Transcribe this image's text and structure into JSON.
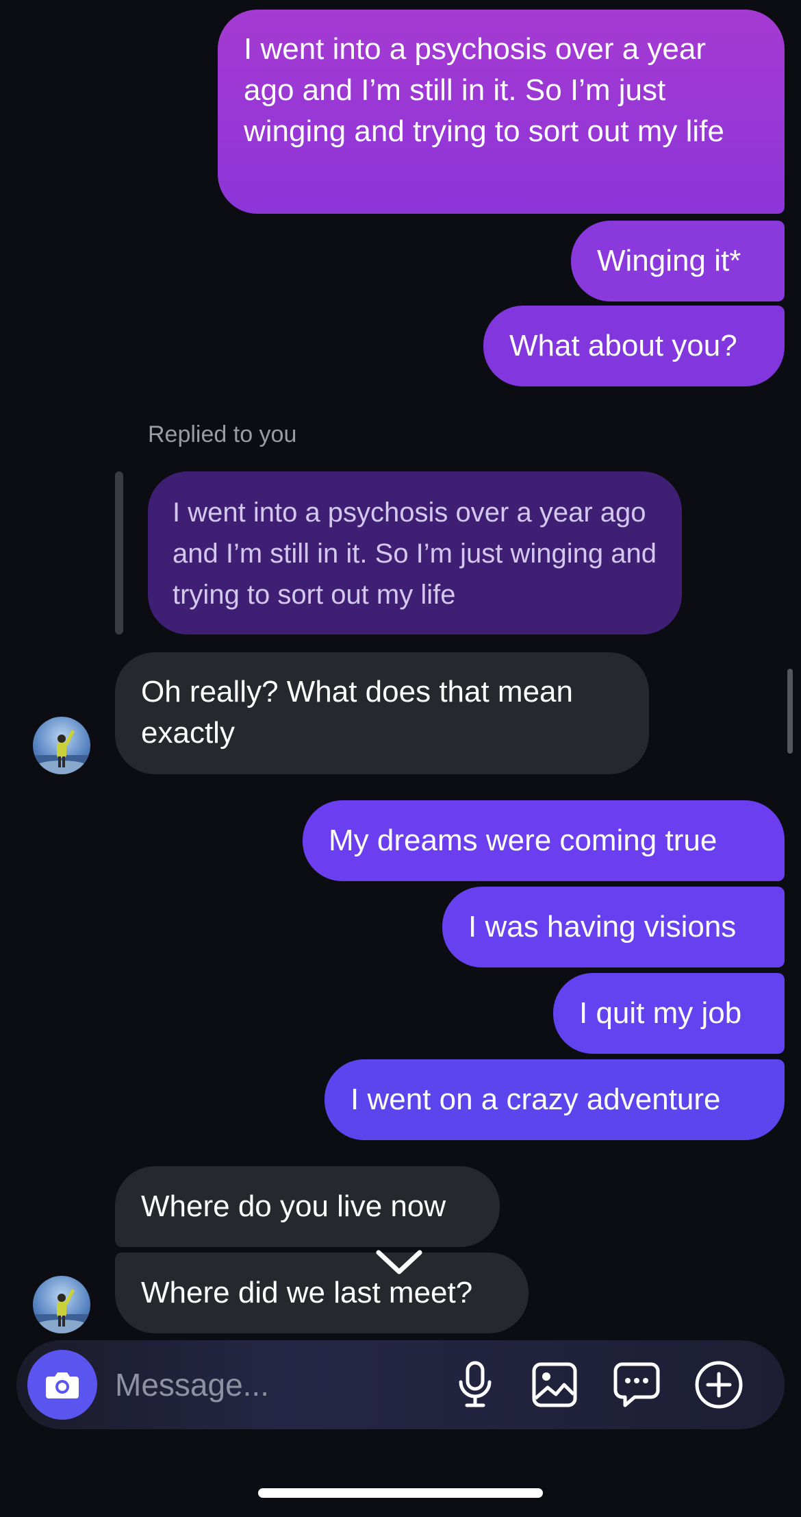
{
  "messages": {
    "out_1": "I went into a psychosis over a year ago and I’m still in it. So I’m just winging and trying to sort out my life",
    "out_2": "Winging it*",
    "out_3": "What about you?",
    "replied_label": "Replied to you",
    "reply_quote": "I went into a psychosis over a year ago and I’m still in it. So I’m just winging and trying to sort out my life",
    "in_1": "Oh really? What does that mean exactly",
    "out_4": "My dreams were coming true",
    "out_5": "I was having visions",
    "out_6": "I quit my job",
    "out_7": "I went on a crazy adventure",
    "in_2": "Where do you live now",
    "in_3": "Where did we last meet?"
  },
  "composer": {
    "placeholder": "Message..."
  },
  "icons": {
    "camera": "camera-icon",
    "mic": "microphone-icon",
    "gallery": "image-icon",
    "sticker": "chat-bubble-icon",
    "add": "plus-circle-icon",
    "scroll_down": "chevron-down-icon"
  },
  "colors": {
    "background": "#0b0d12",
    "outgoing_purple": "#a63ad2",
    "outgoing_blue": "#6243ef",
    "incoming": "#26282d",
    "camera_button": "#5b55f0"
  }
}
